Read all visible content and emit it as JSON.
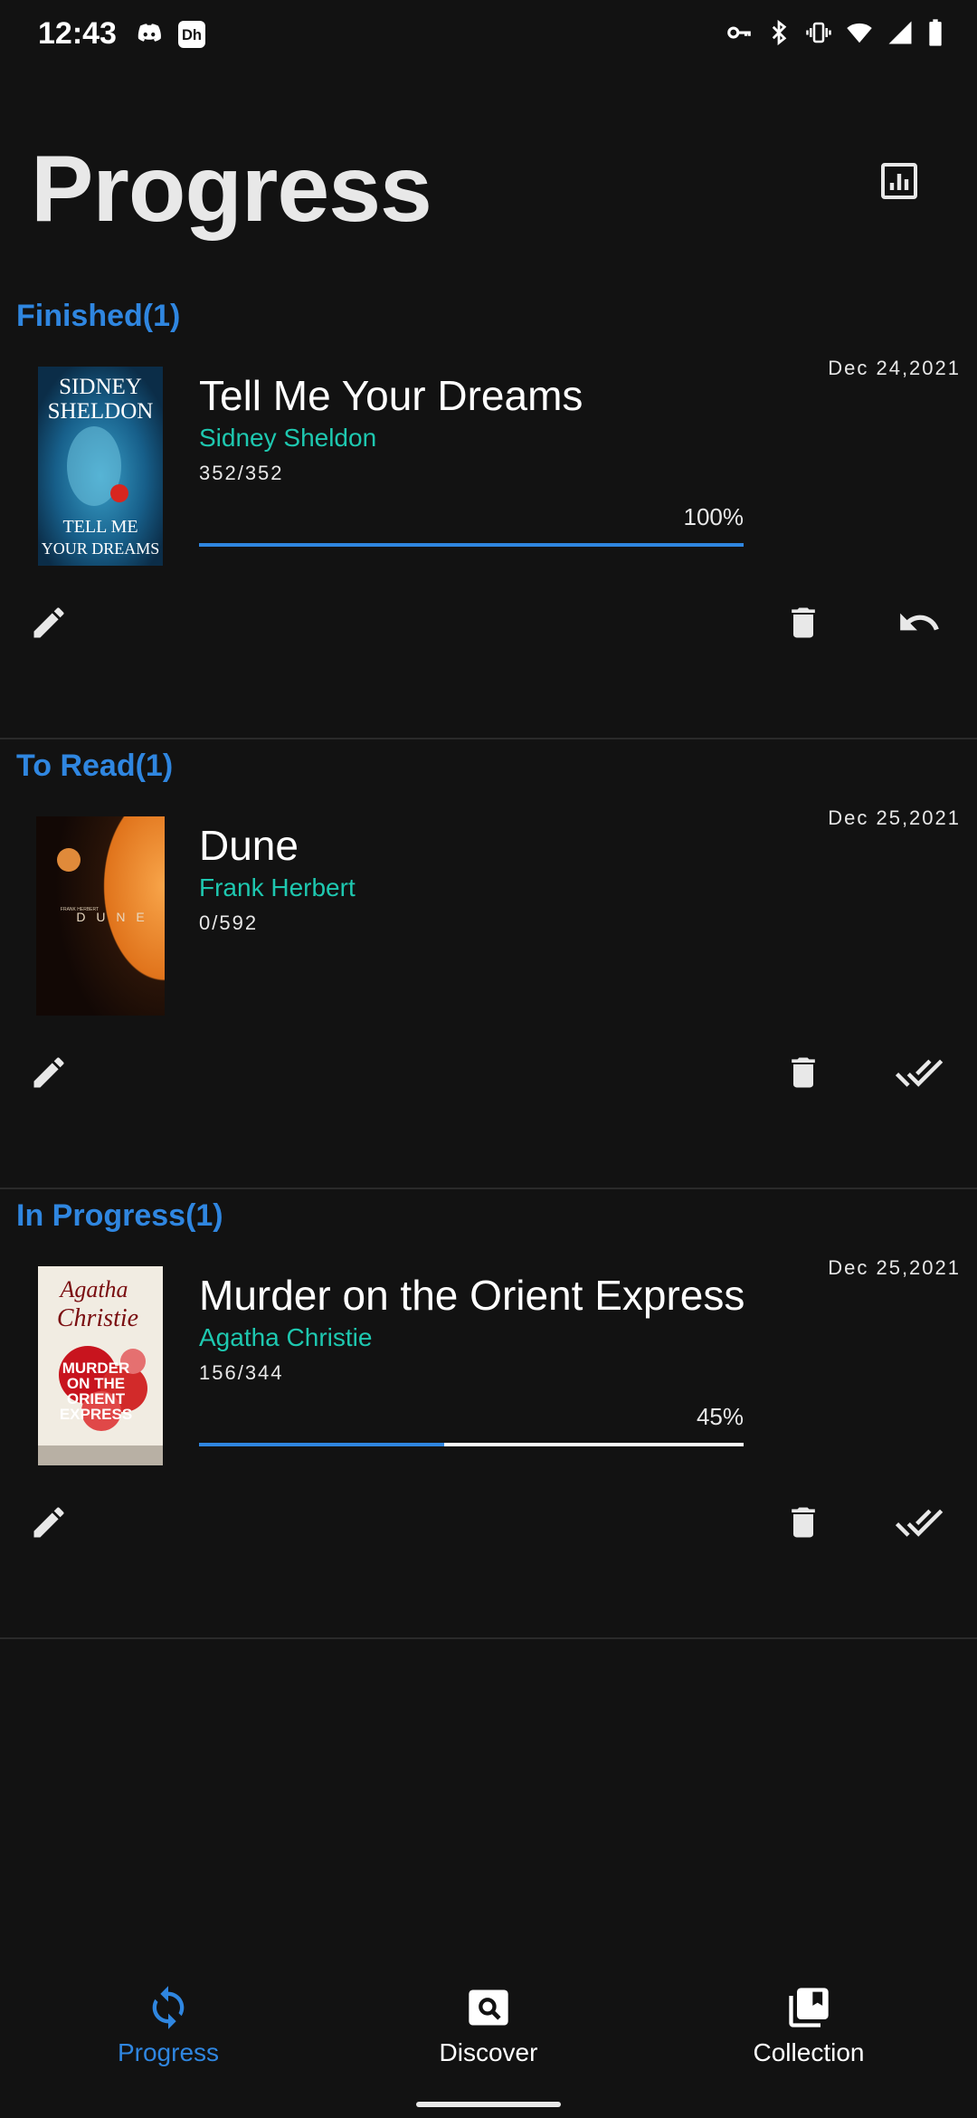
{
  "status_bar": {
    "time": "12:43",
    "left_icons": [
      "discord-icon",
      "disney-plus-icon"
    ],
    "right_icons": [
      "vpn-key-icon",
      "bluetooth-icon",
      "vibrate-icon",
      "wifi-icon",
      "signal-icon",
      "battery-icon"
    ]
  },
  "header": {
    "title": "Progress",
    "stats_icon": "bar-chart-icon"
  },
  "sections": [
    {
      "label": "Finished(1)",
      "book": {
        "title": "Tell Me Your Dreams",
        "author": "Sidney Sheldon",
        "pages": "352/352",
        "date": "Dec 24,2021",
        "percent_label": "100%",
        "progress": 1.0,
        "cover_text": [
          "SIDNEY",
          "SHELDON",
          "TELL ME",
          "YOUR DREAMS"
        ],
        "third_action_icon": "undo-icon"
      }
    },
    {
      "label": "To Read(1)",
      "book": {
        "title": "Dune",
        "author": "Frank Herbert",
        "pages": "0/592",
        "date": "Dec 25,2021",
        "cover_text": [
          "FRANK HERBERT",
          "D U N E"
        ],
        "third_action_icon": "double-check-icon"
      }
    },
    {
      "label": "In Progress(1)",
      "book": {
        "title": "Murder on the Orient Express",
        "author": "Agatha Christie",
        "pages": "156/344",
        "date": "Dec 25,2021",
        "percent_label": "45%",
        "progress": 0.45,
        "cover_text": [
          "Agatha",
          "Christie",
          "MURDER",
          "ON THE",
          "ORIENT",
          "EXPRESS"
        ],
        "third_action_icon": "double-check-icon"
      }
    }
  ],
  "bottom_nav": [
    {
      "label": "Progress",
      "icon": "sync-icon",
      "active": true
    },
    {
      "label": "Discover",
      "icon": "search-icon",
      "active": false
    },
    {
      "label": "Collection",
      "icon": "collection-icon",
      "active": false
    }
  ],
  "colors": {
    "background": "#121212",
    "accent": "#2f86e0",
    "author": "#1ec8b0",
    "title_gray": "#e8e8e8"
  }
}
